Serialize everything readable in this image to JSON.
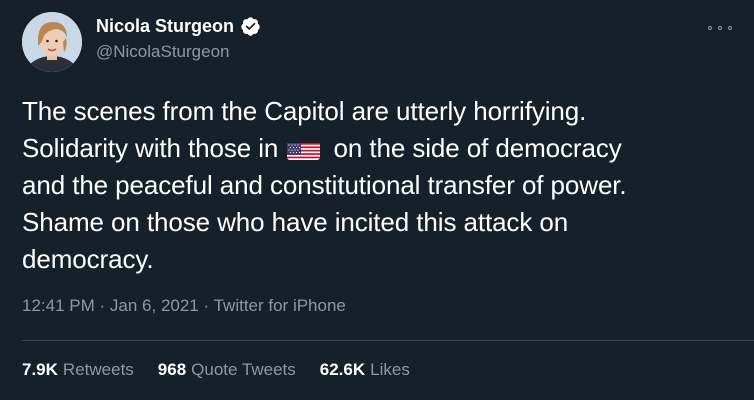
{
  "author": {
    "display_name": "Nicola Sturgeon",
    "handle": "@NicolaSturgeon",
    "verified": true,
    "verified_icon": "verified-badge-icon",
    "avatar_icon": "profile-photo"
  },
  "tweet": {
    "lines": [
      "The scenes from the Capitol are utterly horrifying.",
      "Solidarity with those in",
      "on the side of democracy",
      "and the peaceful and constitutional transfer of power.",
      "Shame on those who have incited this attack on",
      "democracy."
    ],
    "emoji": "us-flag-icon"
  },
  "meta": {
    "time": "12:41 PM",
    "separator": "·",
    "date": "Jan 6, 2021",
    "source": "Twitter for iPhone"
  },
  "stats": {
    "retweets_count": "7.9K",
    "retweets_label": "Retweets",
    "quotes_count": "968",
    "quotes_label": "Quote Tweets",
    "likes_count": "62.6K",
    "likes_label": "Likes"
  },
  "colors": {
    "background": "#15202b",
    "text": "#ffffff",
    "secondary": "#8899a6",
    "divider": "#38444d",
    "verified": "#ffffff"
  },
  "more_icon": "more-horizontal-icon"
}
